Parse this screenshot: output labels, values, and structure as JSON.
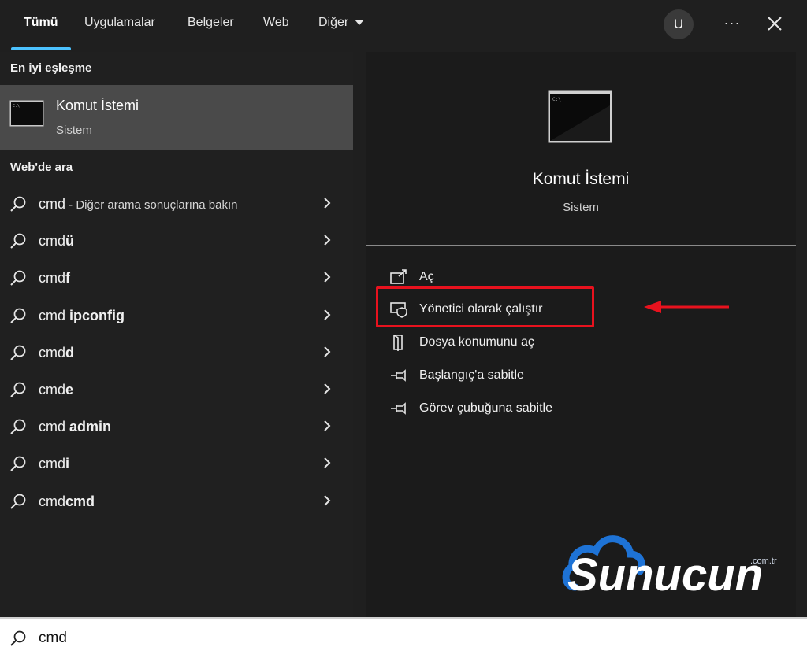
{
  "tabs": [
    {
      "label": "Tümü",
      "active": true
    },
    {
      "label": "Uygulamalar"
    },
    {
      "label": "Belgeler"
    },
    {
      "label": "Web"
    },
    {
      "label": "Diğer"
    }
  ],
  "header": {
    "avatar_letter": "U",
    "more_label": "···"
  },
  "best_match": {
    "section_title": "En iyi eşleşme",
    "title": "Komut İstemi",
    "subtitle": "Sistem"
  },
  "web_search": {
    "section_title": "Web'de ara",
    "items": [
      {
        "prefix": "cmd",
        "bold": "",
        "hint": " - Diğer arama sonuçlarına bakın"
      },
      {
        "prefix": "cmd",
        "bold": "ü",
        "hint": ""
      },
      {
        "prefix": "cmd",
        "bold": "f",
        "hint": ""
      },
      {
        "prefix": "cmd ",
        "bold": "ipconfig",
        "hint": ""
      },
      {
        "prefix": "cmd",
        "bold": "d",
        "hint": ""
      },
      {
        "prefix": "cmd",
        "bold": "e",
        "hint": ""
      },
      {
        "prefix": "cmd ",
        "bold": "admin",
        "hint": ""
      },
      {
        "prefix": "cmd",
        "bold": "i",
        "hint": ""
      },
      {
        "prefix": "cmd",
        "bold": "cmd",
        "hint": ""
      }
    ]
  },
  "details": {
    "title": "Komut İstemi",
    "subtitle": "Sistem",
    "actions": [
      {
        "label": "Aç",
        "icon": "open-icon"
      },
      {
        "label": "Yönetici olarak çalıştır",
        "icon": "shield-admin-icon"
      },
      {
        "label": "Dosya konumunu aç",
        "icon": "file-location-icon"
      },
      {
        "label": "Başlangıç'a sabitle",
        "icon": "pin-icon"
      },
      {
        "label": "Görev çubuğuna sabitle",
        "icon": "pin-icon"
      }
    ]
  },
  "logo": {
    "text": "Sunucun",
    "tld": ".com.tr"
  },
  "search": {
    "value": "cmd"
  },
  "colors": {
    "accent": "#4cc2ff",
    "highlight": "#e8121e",
    "logo_blue": "#1e73d6"
  }
}
